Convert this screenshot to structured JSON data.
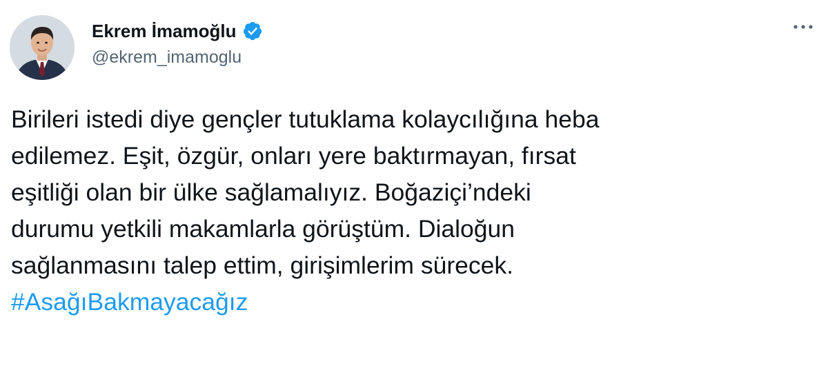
{
  "author": {
    "display_name": "Ekrem İmamoğlu",
    "handle": "@ekrem_imamoglu",
    "verified": true
  },
  "tweet": {
    "lines": [
      "Birileri istedi diye gençler tutuklama kolaycılığına heba",
      "edilemez. Eşit, özgür, onları yere baktırmayan, fırsat",
      "eşitliği olan bir ülke sağlamalıyız. Boğaziçi’ndeki",
      "durumu yetkili makamlarla görüştüm. Dialoğun",
      "sağlanmasını talep ettim, girişimlerim sürecek."
    ],
    "hashtag": "#AsağıBakmayacağız"
  },
  "icons": {
    "verified": "verified-badge-icon",
    "more": "more-options-icon"
  },
  "colors": {
    "text": "#0f1419",
    "secondary_text": "#536471",
    "link": "#1d9bf0",
    "verified_badge": "#1d9bf0"
  }
}
